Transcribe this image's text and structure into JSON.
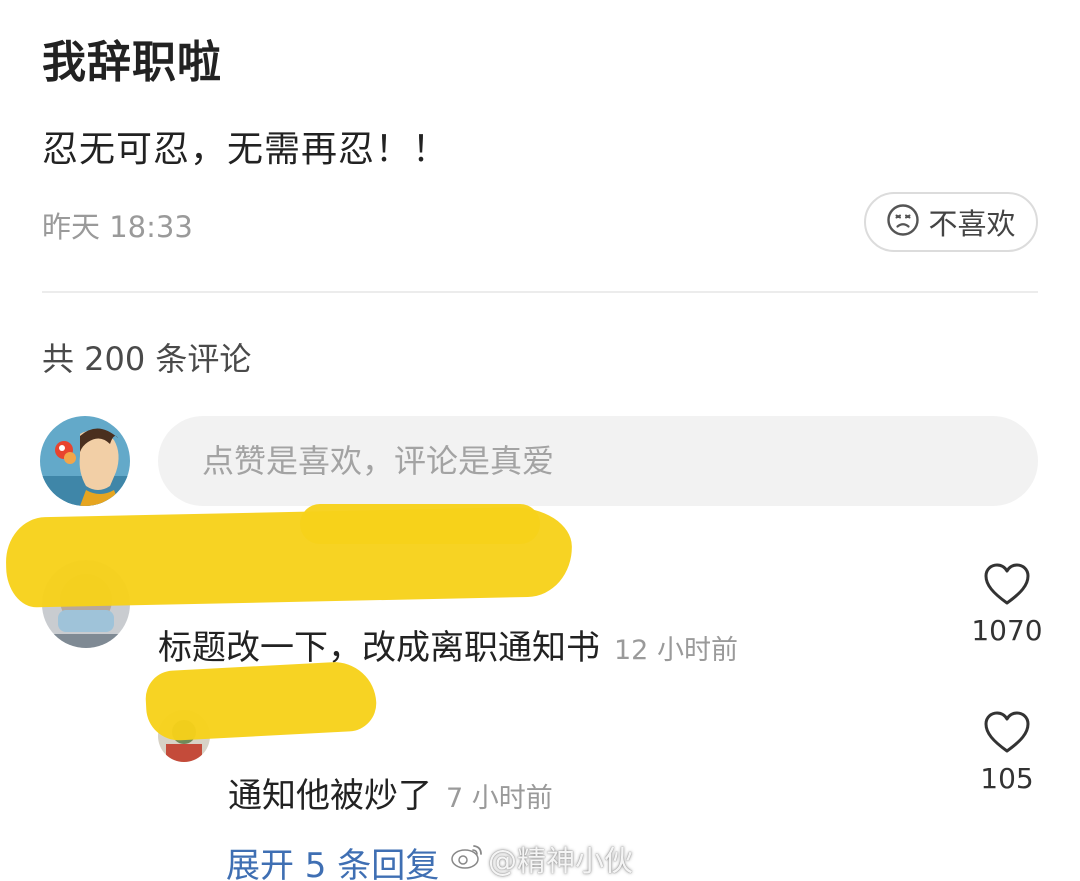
{
  "post": {
    "title": "我辞职啦",
    "body": "忍无可忍，无需再忍！！",
    "time": "昨天 18:33",
    "dislike_label": "不喜欢"
  },
  "comments_header": {
    "count_text": "共 200 条评论"
  },
  "comment_input": {
    "placeholder": "点赞是喜欢，评论是真爱"
  },
  "comments": [
    {
      "text": "标题改一下，改成离职通知书",
      "time": "12 小时前",
      "likes": "1070"
    },
    {
      "text": "通知他被炒了",
      "time": "7 小时前",
      "likes": "105"
    }
  ],
  "expand_replies": "展开 5 条回复",
  "watermark": "@精神小伙",
  "icons": {
    "dislike": "frowning-face-icon",
    "like": "heart-outline-icon",
    "watermark": "weibo-icon"
  },
  "colors": {
    "link": "#3f6fb3",
    "redaction": "#f7d11a"
  }
}
